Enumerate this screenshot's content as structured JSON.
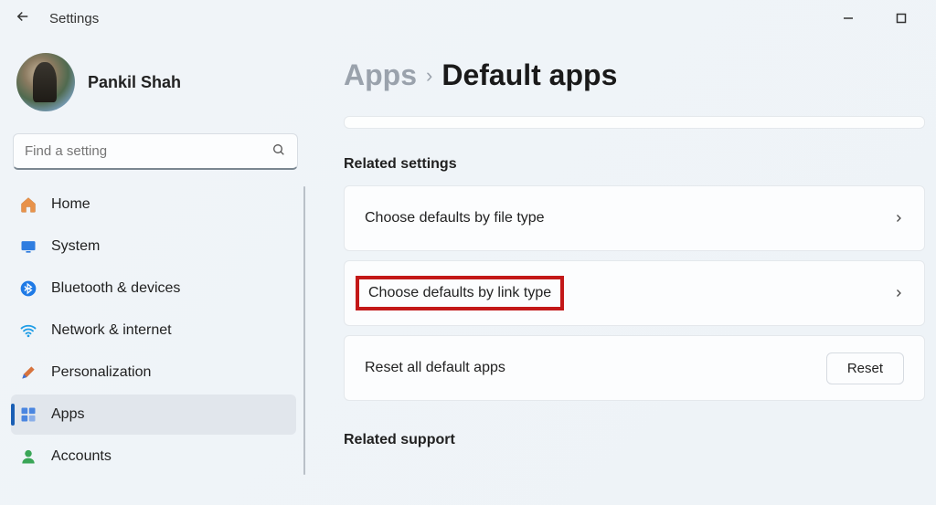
{
  "window": {
    "title": "Settings"
  },
  "profile": {
    "name": "Pankil Shah"
  },
  "search": {
    "placeholder": "Find a setting"
  },
  "sidebar": {
    "items": [
      {
        "label": "Home"
      },
      {
        "label": "System"
      },
      {
        "label": "Bluetooth & devices"
      },
      {
        "label": "Network & internet"
      },
      {
        "label": "Personalization"
      },
      {
        "label": "Apps"
      },
      {
        "label": "Accounts"
      }
    ],
    "selected_index": 5
  },
  "breadcrumb": {
    "parent": "Apps",
    "separator": "›",
    "current": "Default apps"
  },
  "sections": {
    "related_settings": {
      "title": "Related settings",
      "items": [
        {
          "label": "Choose defaults by file type"
        },
        {
          "label": "Choose defaults by link type"
        }
      ],
      "reset": {
        "label": "Reset all default apps",
        "button": "Reset"
      }
    },
    "related_support": {
      "title": "Related support"
    }
  },
  "highlighted_item_index": 1
}
